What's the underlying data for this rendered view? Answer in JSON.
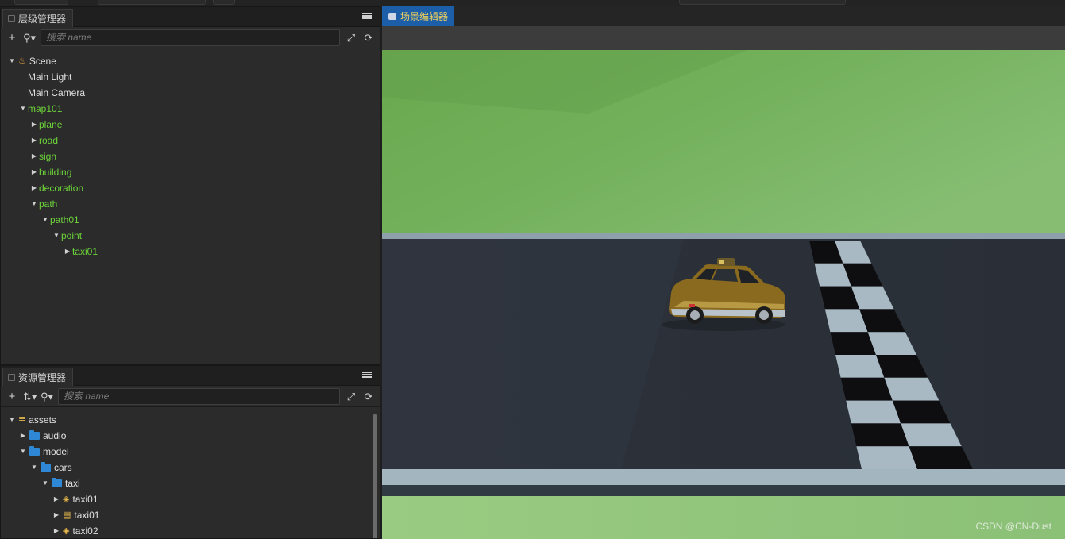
{
  "hierarchy": {
    "tab_title": "层级管理器",
    "search_placeholder": "搜索 name",
    "nodes": [
      {
        "label": "Scene",
        "icon": "scene-flame-icon",
        "expanded": true,
        "depth": 0,
        "color": "white"
      },
      {
        "label": "Main Light",
        "depth": 1,
        "color": "white"
      },
      {
        "label": "Main Camera",
        "depth": 1,
        "color": "white"
      },
      {
        "label": "map101",
        "expanded": true,
        "depth": 1,
        "color": "green"
      },
      {
        "label": "plane",
        "expanded": false,
        "depth": 2,
        "color": "green"
      },
      {
        "label": "road",
        "expanded": false,
        "depth": 2,
        "color": "green"
      },
      {
        "label": "sign",
        "expanded": false,
        "depth": 2,
        "color": "green"
      },
      {
        "label": "building",
        "expanded": false,
        "depth": 2,
        "color": "green"
      },
      {
        "label": "decoration",
        "expanded": false,
        "depth": 2,
        "color": "green"
      },
      {
        "label": "path",
        "expanded": true,
        "depth": 2,
        "color": "green"
      },
      {
        "label": "path01",
        "expanded": true,
        "depth": 3,
        "color": "green"
      },
      {
        "label": "point",
        "expanded": true,
        "depth": 4,
        "color": "green"
      },
      {
        "label": "taxi01",
        "expanded": false,
        "depth": 5,
        "color": "green"
      }
    ]
  },
  "assets": {
    "tab_title": "资源管理器",
    "search_placeholder": "搜索 name",
    "nodes": [
      {
        "label": "assets",
        "icon": "database-icon",
        "expanded": true,
        "depth": 0
      },
      {
        "label": "audio",
        "icon": "folder-icon",
        "expanded": false,
        "depth": 1
      },
      {
        "label": "model",
        "icon": "folder-icon",
        "expanded": true,
        "depth": 1
      },
      {
        "label": "cars",
        "icon": "folder-icon",
        "expanded": true,
        "depth": 2
      },
      {
        "label": "taxi",
        "icon": "folder-icon",
        "expanded": true,
        "depth": 3
      },
      {
        "label": "taxi01",
        "icon": "model-layers-icon",
        "expanded": false,
        "depth": 4
      },
      {
        "label": "taxi01",
        "icon": "prefab-icon",
        "expanded": false,
        "depth": 4
      },
      {
        "label": "taxi02",
        "icon": "model-layers-icon",
        "expanded": false,
        "depth": 4
      }
    ]
  },
  "scene_editor": {
    "tab_title": "场景编辑器",
    "watermark": "CSDN @CN-Dust"
  },
  "colors": {
    "accent_tab": "#1c5fa8",
    "tab_text": "#f2d15a",
    "node_green": "#6dd43a"
  }
}
